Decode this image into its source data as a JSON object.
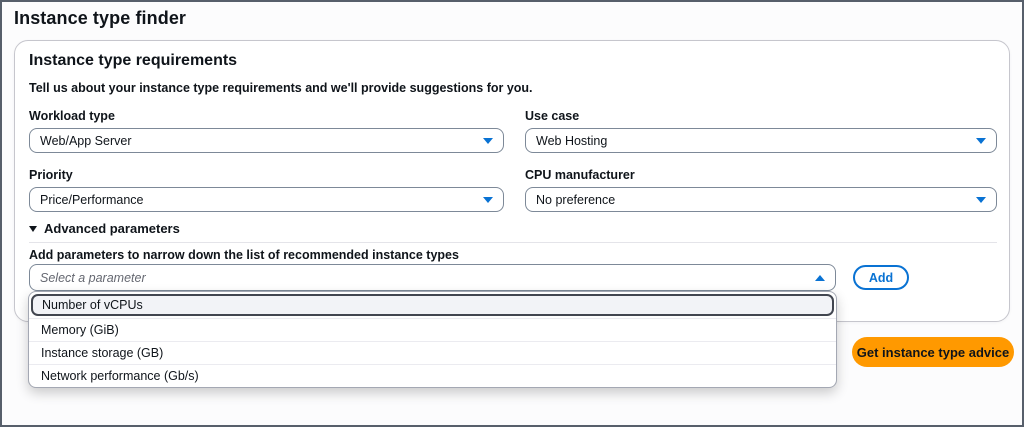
{
  "page": {
    "title": "Instance type finder"
  },
  "card": {
    "heading": "Instance type requirements",
    "description": "Tell us about your instance type requirements and we'll provide suggestions for you.",
    "fields": [
      {
        "label": "Workload type",
        "value": "Web/App Server"
      },
      {
        "label": "Use case",
        "value": "Web Hosting"
      },
      {
        "label": "Priority",
        "value": "Price/Performance"
      },
      {
        "label": "CPU manufacturer",
        "value": "No preference"
      }
    ],
    "advanced": {
      "expander_label": "Advanced parameters",
      "expanded": true,
      "add_params_label": "Add parameters to narrow down the list of recommended instance types",
      "param_select_placeholder": "Select a parameter",
      "add_button_label": "Add"
    }
  },
  "dropdown": {
    "options": [
      {
        "label": "Number of vCPUs",
        "highlighted": true
      },
      {
        "label": "Memory (GiB)",
        "highlighted": false
      },
      {
        "label": "Instance storage (GB)",
        "highlighted": false
      },
      {
        "label": "Network performance (Gb/s)",
        "highlighted": false
      }
    ]
  },
  "actions": {
    "primary_button_label": "Get instance type advice"
  },
  "icons": {
    "select_closed": "caret-down-icon",
    "select_open": "caret-up-icon",
    "expander": "triangle-down-icon"
  },
  "colors": {
    "accent_blue": "#0972d3",
    "primary_orange": "#ff9900",
    "text": "#0f141a",
    "select_border": "#7d8998",
    "card_border": "#c6c6cd",
    "highlight_border": "#424650"
  }
}
